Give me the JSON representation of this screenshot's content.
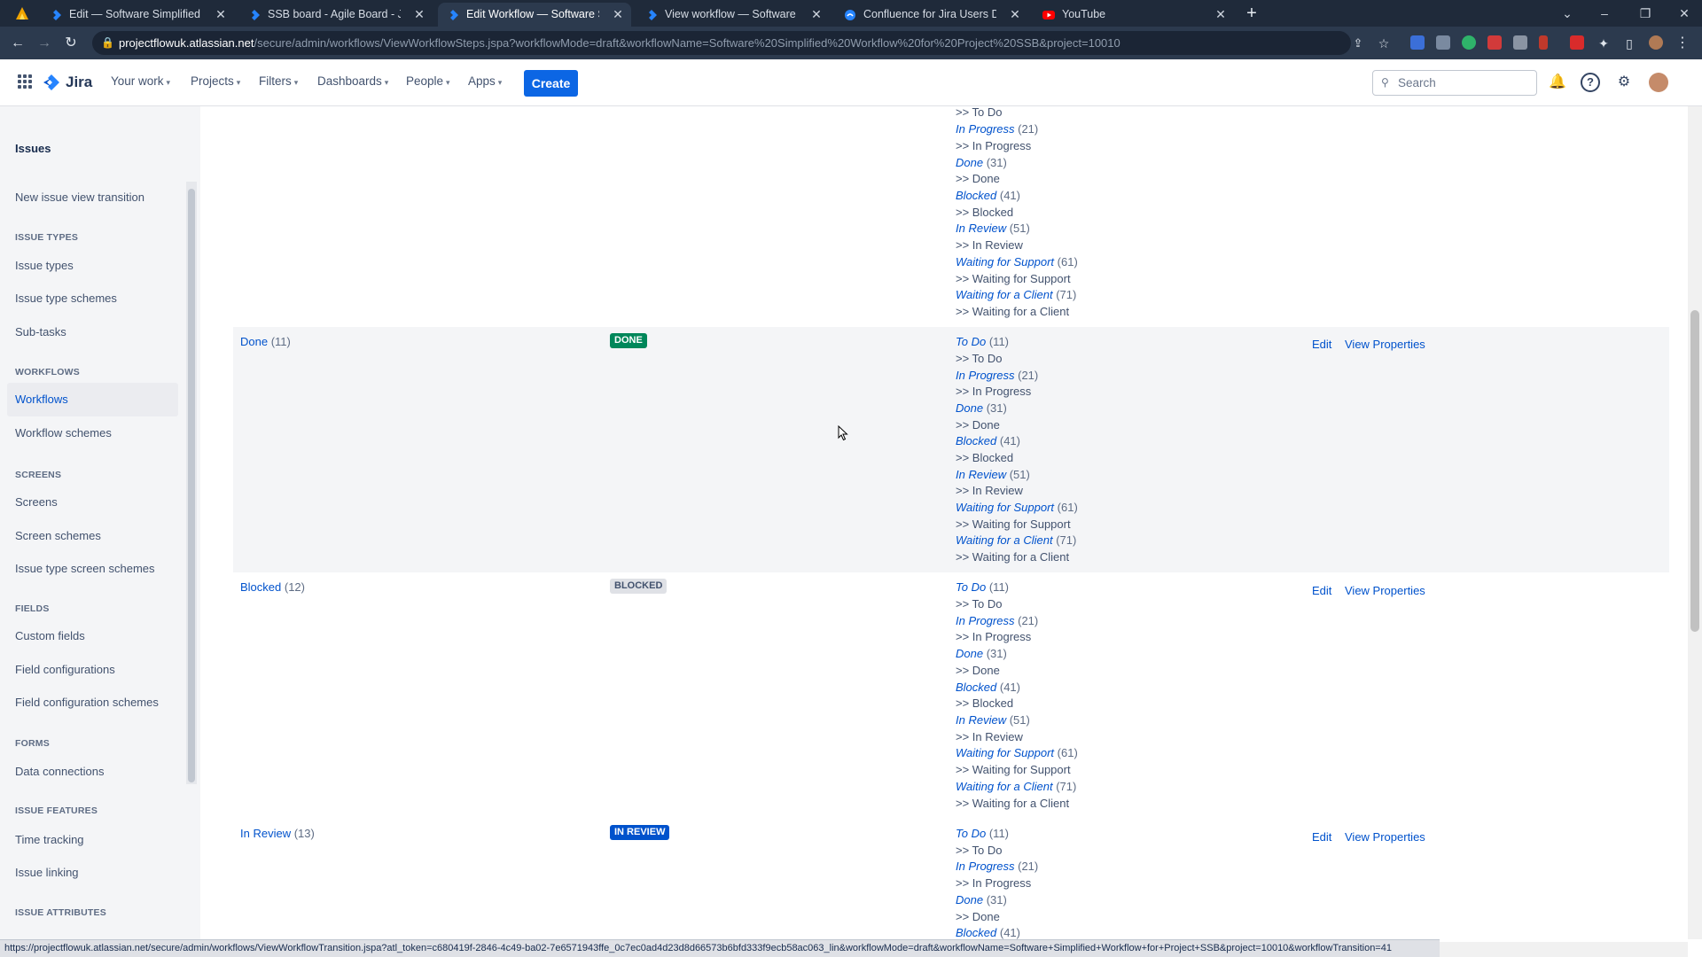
{
  "browser": {
    "tabs": [
      {
        "title": "Edit — Software Simplified Work",
        "icon": "jira-favicon",
        "active": false
      },
      {
        "title": "SSB board - Agile Board - Jira",
        "icon": "jira-favicon",
        "active": false
      },
      {
        "title": "Edit Workflow — Software Simplif",
        "icon": "jira-favicon",
        "active": true
      },
      {
        "title": "View workflow — Software Simpl",
        "icon": "jira-favicon",
        "active": false
      },
      {
        "title": "Confluence for Jira Users Demo",
        "icon": "confluence-favicon",
        "active": false
      },
      {
        "title": "YouTube",
        "icon": "youtube-favicon",
        "active": false
      }
    ],
    "url_host": "projectflowuk.atlassian.net",
    "url_path": "/secure/admin/workflows/ViewWorkflowSteps.jspa?workflowMode=draft&workflowName=Software%20Simplified%20Workflow%20for%20Project%20SSB&project=10010",
    "status_url": "https://projectflowuk.atlassian.net/secure/admin/workflows/ViewWorkflowTransition.jspa?atl_token=c680419f-2846-4c49-ba02-7e6571943ffe_0c7ec0ad4d23d8d66573b6bfd333f9ecb58ac063_lin&workflowMode=draft&workflowName=Software+Simplified+Workflow+for+Project+SSB&project=10010&workflowTransition=41"
  },
  "nav": {
    "logo": "Jira",
    "items": [
      "Your work",
      "Projects",
      "Filters",
      "Dashboards",
      "People",
      "Apps"
    ],
    "create": "Create",
    "search_placeholder": "Search"
  },
  "sidebar": {
    "top": "Issues",
    "transition": "New issue view transition",
    "issue_types_head": "ISSUE TYPES",
    "issue_types": "Issue types",
    "issue_type_schemes": "Issue type schemes",
    "sub_tasks": "Sub-tasks",
    "workflows_head": "WORKFLOWS",
    "workflows": "Workflows",
    "workflow_schemes": "Workflow schemes",
    "screens_head": "SCREENS",
    "screens": "Screens",
    "screen_schemes": "Screen schemes",
    "issue_type_screen_schemes": "Issue type screen schemes",
    "fields_head": "FIELDS",
    "custom_fields": "Custom fields",
    "field_configurations": "Field configurations",
    "field_configuration_schemes": "Field configuration schemes",
    "forms_head": "FORMS",
    "data_connections": "Data connections",
    "issue_features_head": "ISSUE FEATURES",
    "time_tracking": "Time tracking",
    "issue_linking": "Issue linking",
    "issue_attributes_head": "ISSUE ATTRIBUTES"
  },
  "transitions": {
    "to_do": "To Do",
    "to_do_cnt": "(11)",
    "to_do_dest": ">> To Do",
    "in_progress": "In Progress",
    "in_progress_cnt": "(21)",
    "in_progress_dest": ">> In Progress",
    "done": "Done",
    "done_cnt": "(31)",
    "done_dest": ">> Done",
    "blocked": "Blocked",
    "blocked_cnt": "(41)",
    "blocked_dest": ">> Blocked",
    "in_review": "In Review",
    "in_review_cnt": "(51)",
    "in_review_dest": ">> In Review",
    "waiting_support": "Waiting for Support",
    "waiting_support_cnt": "(61)",
    "waiting_support_dest": ">> Waiting for Support",
    "waiting_client": "Waiting for a Client",
    "waiting_client_cnt": "(71)",
    "waiting_client_dest": ">> Waiting for a Client"
  },
  "steps": {
    "done": {
      "name": "Done",
      "count": "(11)",
      "status": "DONE"
    },
    "blocked": {
      "name": "Blocked",
      "count": "(12)",
      "status": "BLOCKED"
    },
    "in_review": {
      "name": "In Review",
      "count": "(13)",
      "status": "IN REVIEW"
    }
  },
  "ops": {
    "edit": "Edit",
    "view_properties": "View Properties"
  }
}
